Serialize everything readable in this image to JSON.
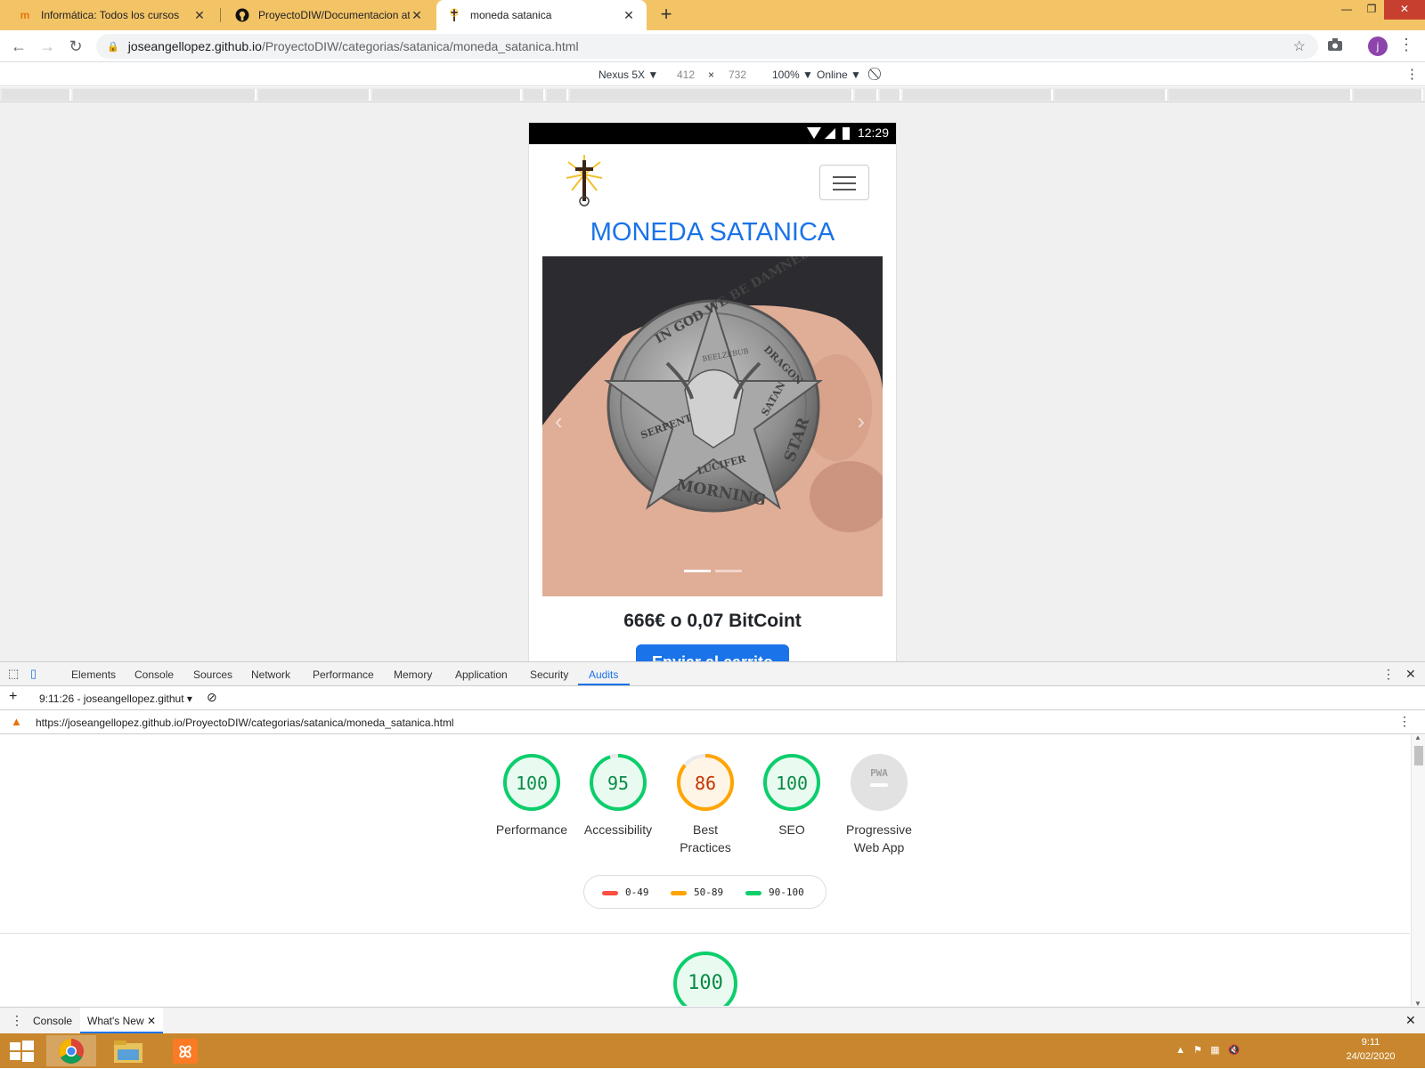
{
  "browser": {
    "tabs": [
      {
        "title": "Informática: Todos los cursos"
      },
      {
        "title": "ProyectoDIW/Documentacion at"
      },
      {
        "title": "moneda satanica"
      }
    ],
    "url_host": "joseangellopez.github.io",
    "url_path": "/ProyectoDIW/categorias/satanica/moneda_satanica.html"
  },
  "device_toolbar": {
    "device": "Nexus 5X",
    "width": "412",
    "height": "732",
    "zoom": "100%",
    "network": "Online"
  },
  "page": {
    "status_time": "12:29",
    "title": "MONEDA SATANICA",
    "price": "666€ o 0,07 BitCoint",
    "cart_button": "Enviar al carrito",
    "coin_text": {
      "top": "IN GOD WE BE DAMNED",
      "right": "DRAGON",
      "right2": "SATAN",
      "bottom": "MORNING",
      "left": "SERPENT",
      "left2": "LUCIFER",
      "star": "STAR",
      "beelzebub": "BEELZEBUB"
    }
  },
  "devtools": {
    "tabs": [
      "Elements",
      "Console",
      "Sources",
      "Network",
      "Performance",
      "Memory",
      "Application",
      "Security",
      "Audits"
    ],
    "active_tab": "Audits",
    "report_label": "9:11:26 - joseangellopez.githut",
    "report_url": "https://joseangellopez.github.io/ProyectoDIW/categorias/satanica/moneda_satanica.html",
    "scores": [
      {
        "label": "Performance",
        "score": "100",
        "value": 100,
        "color": "#0cce6b"
      },
      {
        "label": "Accessibility",
        "score": "95",
        "value": 95,
        "color": "#0cce6b"
      },
      {
        "label": "Best Practices",
        "score": "86",
        "value": 86,
        "color": "#ffa400"
      },
      {
        "label": "SEO",
        "score": "100",
        "value": 100,
        "color": "#0cce6b"
      },
      {
        "label": "Progressive Web App",
        "score": "PWA",
        "value": 0,
        "color": "#bdbdbd"
      }
    ],
    "legend": [
      {
        "label": "0-49",
        "color": "#ff4e42"
      },
      {
        "label": "50-89",
        "color": "#ffa400"
      },
      {
        "label": "90-100",
        "color": "#0cce6b"
      }
    ],
    "section_score": "100",
    "drawer_tabs": [
      "Console",
      "What's New"
    ]
  },
  "taskbar": {
    "time": "9:11",
    "date": "24/02/2020"
  }
}
